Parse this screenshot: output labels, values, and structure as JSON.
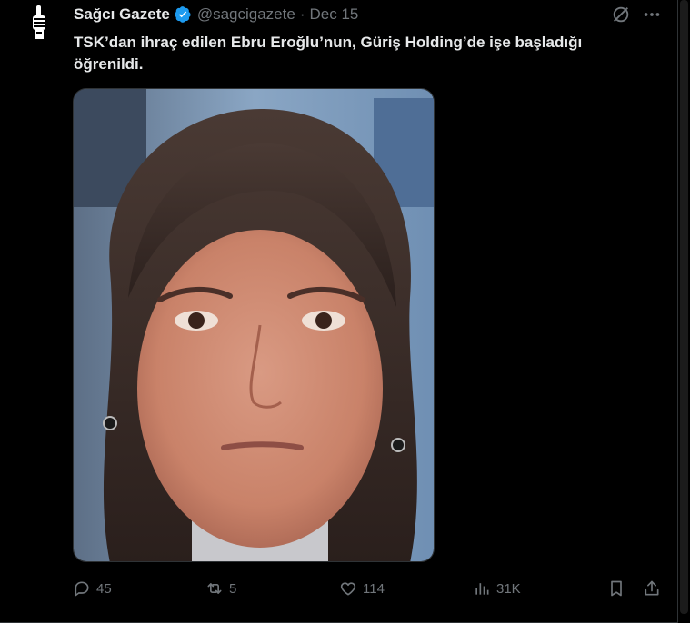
{
  "tweet": {
    "display_name": "Sağcı Gazete",
    "handle": "@sagcigazete",
    "separator": "·",
    "date": "Dec 15",
    "verified": true,
    "text": "TSK’dan ihraç edilen Ebru Eroğlu’nun, Güriş Holding’de işe başladığı öğrenildi.",
    "media_alt": "photo-of-woman"
  },
  "actions": {
    "replies": "45",
    "reposts": "5",
    "likes": "114",
    "views": "31K"
  },
  "colors": {
    "background": "#000000",
    "text": "#e7e9ea",
    "muted": "#71767b",
    "verified": "#1d9bf0",
    "border": "#2f3336"
  },
  "icons": {
    "avatar": "raised-fist-logo",
    "verified": "verified-badge-icon",
    "grok": "grok-icon",
    "more": "more-dots-icon",
    "reply": "reply-icon",
    "repost": "repost-icon",
    "like": "heart-icon",
    "views": "views-icon",
    "bookmark": "bookmark-icon",
    "share": "share-icon"
  }
}
